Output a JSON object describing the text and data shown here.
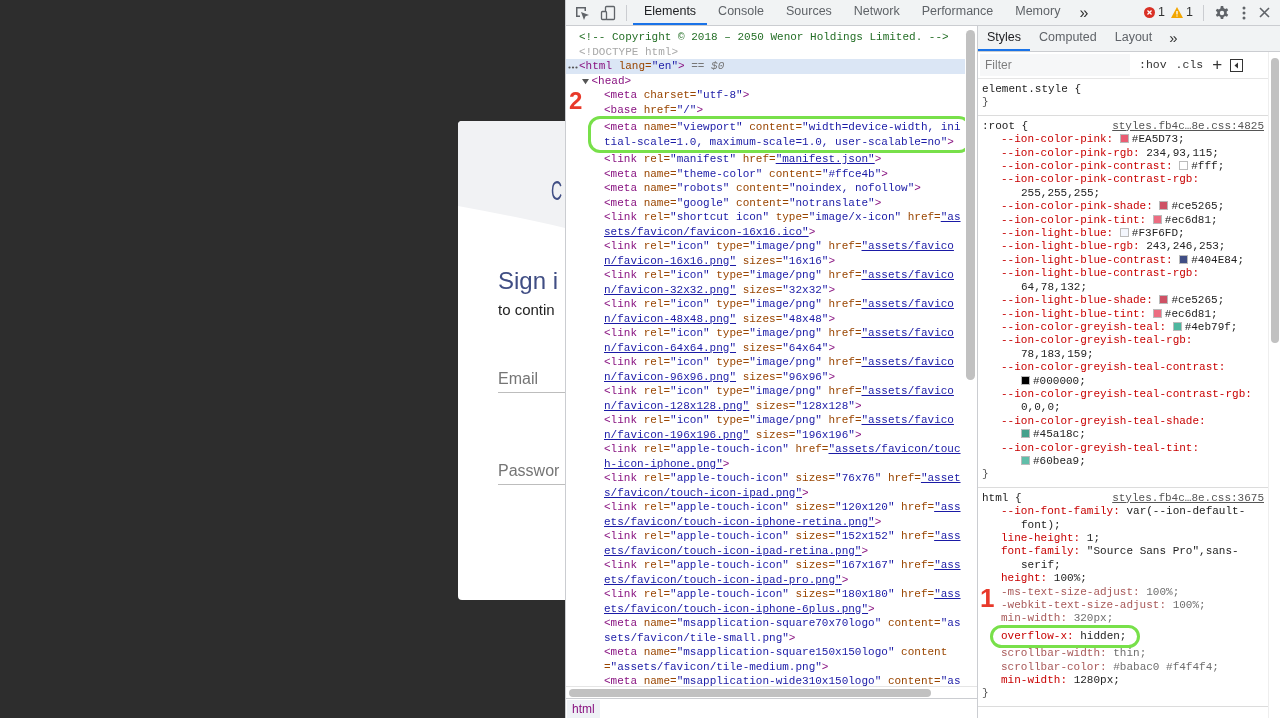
{
  "page": {
    "logo_letter": "C",
    "heading": "Sign i",
    "subheading": "to contin",
    "fields": [
      {
        "placeholder": "Email"
      },
      {
        "placeholder": "Passwor"
      }
    ]
  },
  "toolbar": {
    "tabs": [
      {
        "label": "Elements",
        "selected": true
      },
      {
        "label": "Console",
        "selected": false
      },
      {
        "label": "Sources",
        "selected": false
      },
      {
        "label": "Network",
        "selected": false
      },
      {
        "label": "Performance",
        "selected": false
      },
      {
        "label": "Memory",
        "selected": false
      }
    ],
    "more": "»",
    "errors": "1",
    "warnings": "1"
  },
  "elements_panel": {
    "nodes": [
      {
        "kind": "comment",
        "text": "<!-- Copyright ©  2018 – 2050 Wenor Holdings Limited. -->",
        "selected": false
      },
      {
        "kind": "doctype",
        "text": "<!DOCTYPE html>",
        "selected": false
      },
      {
        "kind": "element",
        "open": "<html",
        "attrs": [
          {
            "name": "lang=",
            "value": "\"en\""
          }
        ],
        "close": ">",
        "marker": "== $0",
        "selected": true,
        "children": [
          {
            "kind": "element",
            "open": "<head",
            "close": ">",
            "expanded": true,
            "selected": false,
            "children": [
              {
                "kind": "element",
                "open": "<meta",
                "attrs": [
                  {
                    "name": "charset=",
                    "value": "\"utf-8\""
                  }
                ],
                "close": ">",
                "selected": false
              },
              {
                "kind": "element",
                "open": "<base",
                "attrs": [
                  {
                    "name": "href=",
                    "value": "\"/\""
                  }
                ],
                "close": ">",
                "selected": false
              },
              {
                "kind": "element",
                "open": "<meta",
                "attrs": [
                  {
                    "name": "name=",
                    "value": "\"viewport\""
                  },
                  {
                    "name": "content=",
                    "value": "\"width=device-width, initial-scale=1.0, maximum-scale=1.0, user-scalable=no\""
                  }
                ],
                "close": ">",
                "selected": false,
                "highlight": true,
                "callout": "2"
              },
              {
                "kind": "element",
                "open": "<link",
                "attrs": [
                  {
                    "name": "rel=",
                    "value": "\"manifest\""
                  },
                  {
                    "name": "href=",
                    "value": "\"manifest.json\"",
                    "link": true
                  }
                ],
                "close": ">",
                "selected": false
              },
              {
                "kind": "element",
                "open": "<meta",
                "attrs": [
                  {
                    "name": "name=",
                    "value": "\"theme-color\""
                  },
                  {
                    "name": "content=",
                    "value": "\"#ffce4b\""
                  }
                ],
                "close": ">",
                "selected": false
              },
              {
                "kind": "element",
                "open": "<meta",
                "attrs": [
                  {
                    "name": "name=",
                    "value": "\"robots\""
                  },
                  {
                    "name": "content=",
                    "value": "\"noindex, nofollow\""
                  }
                ],
                "close": ">",
                "selected": false
              },
              {
                "kind": "element",
                "open": "<meta",
                "attrs": [
                  {
                    "name": "name=",
                    "value": "\"google\""
                  },
                  {
                    "name": "content=",
                    "value": "\"notranslate\""
                  }
                ],
                "close": ">",
                "selected": false
              },
              {
                "kind": "element",
                "open": "<link",
                "attrs": [
                  {
                    "name": "rel=",
                    "value": "\"shortcut icon\""
                  },
                  {
                    "name": "type=",
                    "value": "\"image/x-icon\""
                  },
                  {
                    "name": "href=",
                    "value": "\"assets/favicon/favicon-16x16.ico\"",
                    "link": true
                  }
                ],
                "close": ">",
                "selected": false
              },
              {
                "kind": "element",
                "open": "<link",
                "attrs": [
                  {
                    "name": "rel=",
                    "value": "\"icon\""
                  },
                  {
                    "name": "type=",
                    "value": "\"image/png\""
                  },
                  {
                    "name": "href=",
                    "value": "\"assets/favicon/favicon-16x16.png\"",
                    "link": true
                  },
                  {
                    "name": "sizes=",
                    "value": "\"16x16\""
                  }
                ],
                "close": ">",
                "selected": false
              },
              {
                "kind": "element",
                "open": "<link",
                "attrs": [
                  {
                    "name": "rel=",
                    "value": "\"icon\""
                  },
                  {
                    "name": "type=",
                    "value": "\"image/png\""
                  },
                  {
                    "name": "href=",
                    "value": "\"assets/favicon/favicon-32x32.png\"",
                    "link": true
                  },
                  {
                    "name": "sizes=",
                    "value": "\"32x32\""
                  }
                ],
                "close": ">",
                "selected": false
              },
              {
                "kind": "element",
                "open": "<link",
                "attrs": [
                  {
                    "name": "rel=",
                    "value": "\"icon\""
                  },
                  {
                    "name": "type=",
                    "value": "\"image/png\""
                  },
                  {
                    "name": "href=",
                    "value": "\"assets/favicon/favicon-48x48.png\"",
                    "link": true
                  },
                  {
                    "name": "sizes=",
                    "value": "\"48x48\""
                  }
                ],
                "close": ">",
                "selected": false
              },
              {
                "kind": "element",
                "open": "<link",
                "attrs": [
                  {
                    "name": "rel=",
                    "value": "\"icon\""
                  },
                  {
                    "name": "type=",
                    "value": "\"image/png\""
                  },
                  {
                    "name": "href=",
                    "value": "\"assets/favicon/favicon-64x64.png\"",
                    "link": true
                  },
                  {
                    "name": "sizes=",
                    "value": "\"64x64\""
                  }
                ],
                "close": ">",
                "selected": false
              },
              {
                "kind": "element",
                "open": "<link",
                "attrs": [
                  {
                    "name": "rel=",
                    "value": "\"icon\""
                  },
                  {
                    "name": "type=",
                    "value": "\"image/png\""
                  },
                  {
                    "name": "href=",
                    "value": "\"assets/favicon/favicon-96x96.png\"",
                    "link": true
                  },
                  {
                    "name": "sizes=",
                    "value": "\"96x96\""
                  }
                ],
                "close": ">",
                "selected": false
              },
              {
                "kind": "element",
                "open": "<link",
                "attrs": [
                  {
                    "name": "rel=",
                    "value": "\"icon\""
                  },
                  {
                    "name": "type=",
                    "value": "\"image/png\""
                  },
                  {
                    "name": "href=",
                    "value": "\"assets/favicon/favicon-128x128.png\"",
                    "link": true
                  },
                  {
                    "name": "sizes=",
                    "value": "\"128x128\""
                  }
                ],
                "close": ">",
                "selected": false
              },
              {
                "kind": "element",
                "open": "<link",
                "attrs": [
                  {
                    "name": "rel=",
                    "value": "\"icon\""
                  },
                  {
                    "name": "type=",
                    "value": "\"image/png\""
                  },
                  {
                    "name": "href=",
                    "value": "\"assets/favicon/favicon-196x196.png\"",
                    "link": true
                  },
                  {
                    "name": "sizes=",
                    "value": "\"196x196\""
                  }
                ],
                "close": ">",
                "selected": false
              },
              {
                "kind": "element",
                "open": "<link",
                "attrs": [
                  {
                    "name": "rel=",
                    "value": "\"apple-touch-icon\""
                  },
                  {
                    "name": "href=",
                    "value": "\"assets/favicon/touch-icon-iphone.png\"",
                    "link": true
                  }
                ],
                "close": ">",
                "selected": false
              },
              {
                "kind": "element",
                "open": "<link",
                "attrs": [
                  {
                    "name": "rel=",
                    "value": "\"apple-touch-icon\""
                  },
                  {
                    "name": "sizes=",
                    "value": "\"76x76\""
                  },
                  {
                    "name": "href=",
                    "value": "\"assets/favicon/touch-icon-ipad.png\"",
                    "link": true
                  }
                ],
                "close": ">",
                "selected": false
              },
              {
                "kind": "element",
                "open": "<link",
                "attrs": [
                  {
                    "name": "rel=",
                    "value": "\"apple-touch-icon\""
                  },
                  {
                    "name": "sizes=",
                    "value": "\"120x120\""
                  },
                  {
                    "name": "href=",
                    "value": "\"assets/favicon/touch-icon-iphone-retina.png\"",
                    "link": true
                  }
                ],
                "close": ">",
                "selected": false
              },
              {
                "kind": "element",
                "open": "<link",
                "attrs": [
                  {
                    "name": "rel=",
                    "value": "\"apple-touch-icon\""
                  },
                  {
                    "name": "sizes=",
                    "value": "\"152x152\""
                  },
                  {
                    "name": "href=",
                    "value": "\"assets/favicon/touch-icon-ipad-retina.png\"",
                    "link": true
                  }
                ],
                "close": ">",
                "selected": false
              },
              {
                "kind": "element",
                "open": "<link",
                "attrs": [
                  {
                    "name": "rel=",
                    "value": "\"apple-touch-icon\""
                  },
                  {
                    "name": "sizes=",
                    "value": "\"167x167\""
                  },
                  {
                    "name": "href=",
                    "value": "\"assets/favicon/touch-icon-ipad-pro.png\"",
                    "link": true
                  }
                ],
                "close": ">",
                "selected": false
              },
              {
                "kind": "element",
                "open": "<link",
                "attrs": [
                  {
                    "name": "rel=",
                    "value": "\"apple-touch-icon\""
                  },
                  {
                    "name": "sizes=",
                    "value": "\"180x180\""
                  },
                  {
                    "name": "href=",
                    "value": "\"assets/favicon/touch-icon-iphone-6plus.png\"",
                    "link": true
                  }
                ],
                "close": ">",
                "selected": false
              },
              {
                "kind": "element",
                "open": "<meta",
                "attrs": [
                  {
                    "name": "name=",
                    "value": "\"msapplication-square70x70logo\""
                  },
                  {
                    "name": "content=",
                    "value": "\"assets/favicon/tile-small.png\""
                  }
                ],
                "close": ">",
                "selected": false
              },
              {
                "kind": "element",
                "open": "<meta",
                "attrs": [
                  {
                    "name": "name=",
                    "value": "\"msapplication-square150x150logo\""
                  },
                  {
                    "name": "content=",
                    "value": "\"assets/favicon/tile-medium.png\""
                  }
                ],
                "close": ">",
                "selected": false
              },
              {
                "kind": "element",
                "open": "<meta",
                "attrs": [
                  {
                    "name": "name=",
                    "value": "\"msapplication-wide310x150logo\""
                  },
                  {
                    "name": "content=",
                    "value": "\"as"
                  }
                ],
                "selected": false
              }
            ]
          }
        ]
      }
    ],
    "breadcrumb": "html"
  },
  "styles_panel": {
    "tabs": [
      {
        "label": "Styles",
        "selected": true
      },
      {
        "label": "Computed",
        "selected": false
      },
      {
        "label": "Layout",
        "selected": false
      }
    ],
    "more": "»",
    "filter_placeholder": "Filter",
    "hov": ":hov",
    "cls": ".cls",
    "add": "+",
    "rules": [
      {
        "selector": "element.style {",
        "close": "}"
      },
      {
        "selector": ":root {",
        "source": "styles.fb4c…8e.css:4825",
        "close": "}",
        "declarations": [
          {
            "name": "--ion-color-pink:",
            "value": "#EA5D73;",
            "color": "#ea5d73"
          },
          {
            "name": "--ion-color-pink-rgb:",
            "value": "234,93,115;"
          },
          {
            "name": "--ion-color-pink-contrast:",
            "value": "#fff;",
            "color": "#ffffff"
          },
          {
            "name": "--ion-color-pink-contrast-rgb:",
            "value": "255,255,255;"
          },
          {
            "name": "--ion-color-pink-shade:",
            "value": "#ce5265;",
            "color": "#ce5265"
          },
          {
            "name": "--ion-color-pink-tint:",
            "value": "#ec6d81;",
            "color": "#ec6d81"
          },
          {
            "name": "--ion-light-blue:",
            "value": "#F3F6FD;",
            "color": "#f3f6fd"
          },
          {
            "name": "--ion-light-blue-rgb:",
            "value": "243,246,253;"
          },
          {
            "name": "--ion-light-blue-contrast:",
            "value": "#404E84;",
            "color": "#404e84"
          },
          {
            "name": "--ion-light-blue-contrast-rgb:",
            "value": "64,78,132;"
          },
          {
            "name": "--ion-light-blue-shade:",
            "value": "#ce5265;",
            "color": "#ce5265"
          },
          {
            "name": "--ion-light-blue-tint:",
            "value": "#ec6d81;",
            "color": "#ec6d81"
          },
          {
            "name": "--ion-color-greyish-teal:",
            "value": "#4eb79f;",
            "color": "#4eb79f"
          },
          {
            "name": "--ion-color-greyish-teal-rgb:",
            "value": "78,183,159;"
          },
          {
            "name": "--ion-color-greyish-teal-contrast:",
            "value": "#000000;",
            "color": "#000000"
          },
          {
            "name": "--ion-color-greyish-teal-contrast-rgb:",
            "value": "0,0,0;"
          },
          {
            "name": "--ion-color-greyish-teal-shade:",
            "value": "#45a18c;",
            "color": "#45a18c"
          },
          {
            "name": "--ion-color-greyish-teal-tint:",
            "value": "#60bea9;",
            "color": "#60bea9"
          }
        ]
      },
      {
        "selector": "html {",
        "source": "styles.fb4c…8e.css:3675",
        "close": "}",
        "declarations": [
          {
            "name": "--ion-font-family:",
            "value": "var(--ion-default-font);"
          },
          {
            "name": "line-height:",
            "value": "1;"
          },
          {
            "name": "font-family:",
            "value": "\"Source Sans Pro\",sans-serif;"
          },
          {
            "name": "height:",
            "value": "100%;"
          },
          {
            "name": "-ms-text-size-adjust:",
            "value": "100%;",
            "overridden": true
          },
          {
            "name": "-webkit-text-size-adjust:",
            "value": "100%;",
            "overridden": true
          },
          {
            "name": "min-width:",
            "value": "320px;",
            "overridden": true
          },
          {
            "name": "overflow-x:",
            "value": "hidden;",
            "highlight": true,
            "callout": "1"
          },
          {
            "name": "scrollbar-width:",
            "value": "thin;",
            "overridden": true
          },
          {
            "name": "scrollbar-color:",
            "value": "#babac0 #f4f4f4;",
            "overridden": true
          },
          {
            "name": "min-width:",
            "value": "1280px;"
          }
        ]
      }
    ]
  }
}
